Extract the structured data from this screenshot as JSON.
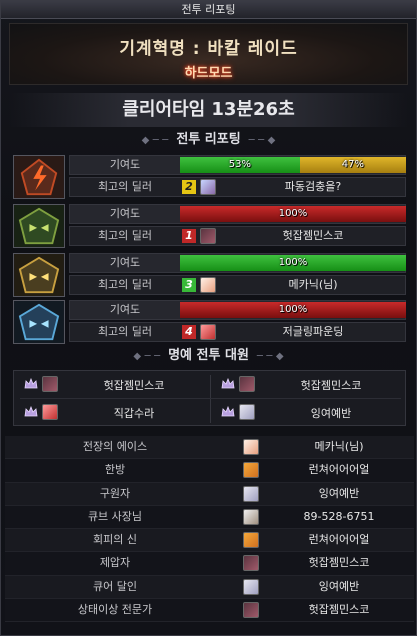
{
  "window": {
    "title": "전투 리포팅"
  },
  "header": {
    "raid_title": "기계혁명 : 바칼 레이드",
    "mode": "하드모드"
  },
  "clear_time": "클리어타임  13분26초",
  "battle_report": {
    "section_title": "전투 리포팅",
    "contribution_label": "기여도",
    "top_dealer_label": "최고의 딜러",
    "bosses": [
      {
        "portrait_icon": "red-boss-portrait",
        "bars": [
          {
            "value": "53%",
            "fraction": 0.53,
            "color": "green"
          },
          {
            "value": "47%",
            "fraction": 0.47,
            "color": "yellow"
          }
        ],
        "rank": "2",
        "rank_color": "yellow",
        "avatar_icon": "player-avatar",
        "dealer": "파동검충을?"
      },
      {
        "portrait_icon": "green-boss-portrait",
        "bars": [
          {
            "value": "100%",
            "fraction": 1.0,
            "color": "red"
          }
        ],
        "rank": "1",
        "rank_color": "red",
        "avatar_icon": "player-avatar",
        "dealer": "헛잡젬민스코"
      },
      {
        "portrait_icon": "gold-boss-portrait",
        "bars": [
          {
            "value": "100%",
            "fraction": 1.0,
            "color": "green"
          }
        ],
        "rank": "3",
        "rank_color": "green",
        "avatar_icon": "player-avatar",
        "dealer": "메카닉(님)"
      },
      {
        "portrait_icon": "blue-boss-portrait",
        "bars": [
          {
            "value": "100%",
            "fraction": 1.0,
            "color": "red"
          }
        ],
        "rank": "4",
        "rank_color": "red",
        "avatar_icon": "player-avatar",
        "dealer": "저글링파운딩"
      }
    ]
  },
  "honor": {
    "section_title": "명예 전투 대원",
    "members": [
      "헛잡젬민스코",
      "헛잡젬민스코",
      "직갑수라",
      "잉여예반"
    ]
  },
  "awards": [
    {
      "title": "전장의 에이스",
      "name": "메카닉(님)"
    },
    {
      "title": "한방",
      "name": "런쳐어어어얼"
    },
    {
      "title": "구원자",
      "name": "잉여예반"
    },
    {
      "title": "큐브 사장님",
      "name": "89-528-6751"
    },
    {
      "title": "회피의 신",
      "name": "런쳐어어어얼"
    },
    {
      "title": "제압자",
      "name": "헛잡젬민스코"
    },
    {
      "title": "큐어 달인",
      "name": "잉여예반"
    },
    {
      "title": "상태이상 전문가",
      "name": "헛잡젬민스코"
    }
  ]
}
